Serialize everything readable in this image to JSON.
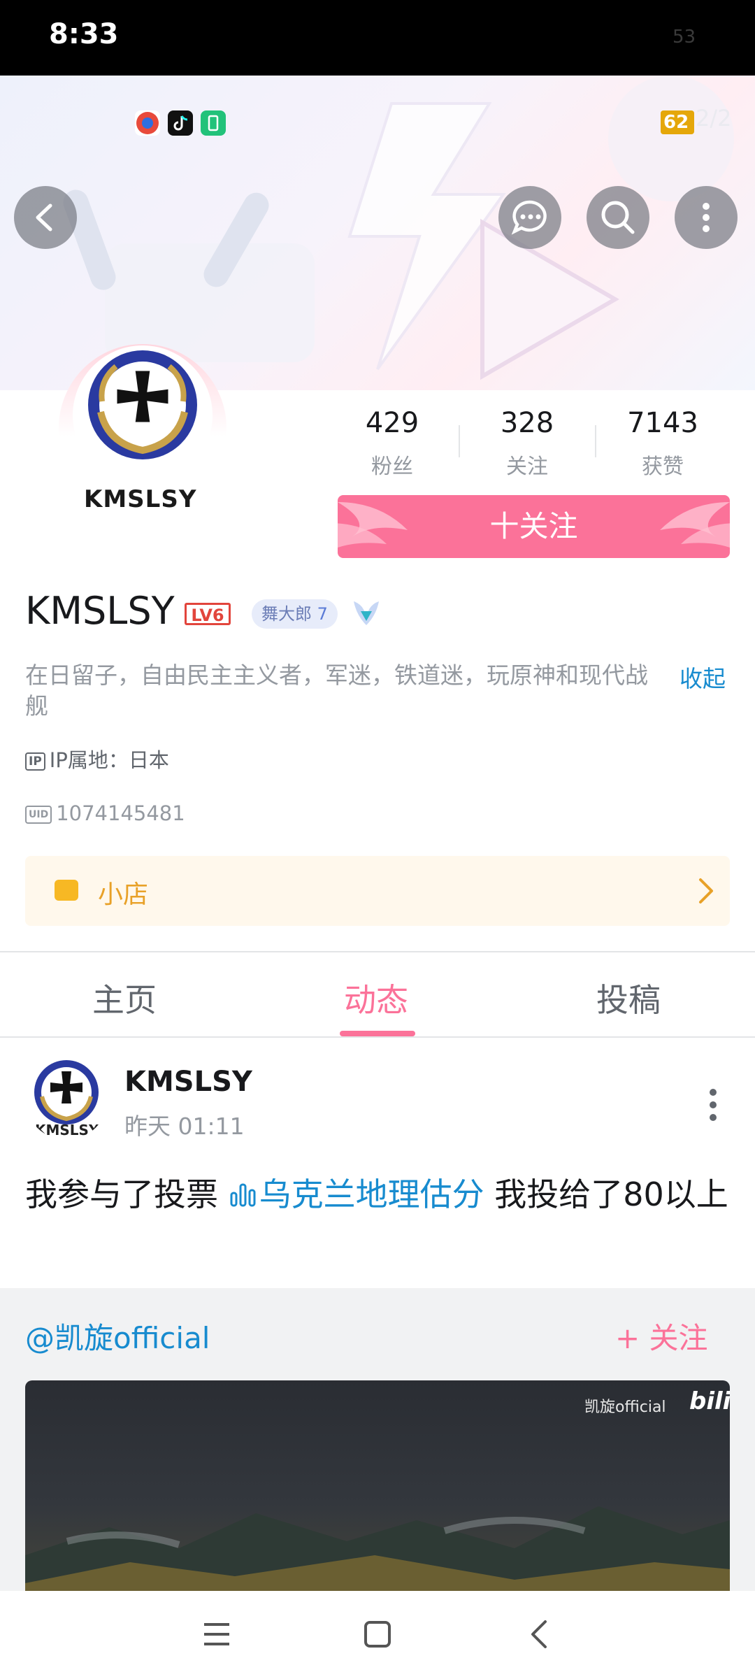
{
  "status": {
    "time": "8:33",
    "right_text": "53",
    "battery": "62",
    "counter": "2/2"
  },
  "colors": {
    "accent": "#fb7299",
    "link": "#178bcf",
    "level": "#e2453c",
    "shop": "#e8a128"
  },
  "header_buttons": [
    "back-icon",
    "message-icon",
    "search-icon",
    "more-icon"
  ],
  "profile": {
    "avatar_caption": "KMSLSY",
    "stats": [
      {
        "value": "429",
        "label": "粉丝"
      },
      {
        "value": "328",
        "label": "关注"
      },
      {
        "value": "7143",
        "label": "获赞"
      }
    ],
    "follow_label": "十关注",
    "name": "KMSLSY",
    "level": "LV6",
    "medal_name": "舞大郎",
    "medal_level": "7",
    "bio": "在日留子，自由民主主义者，军迷，铁道迷，玩原神和现代战舰",
    "collapse_label": "收起",
    "ip_icon": "IP",
    "ip_text": "IP属地：日本",
    "uid_icon": "UID",
    "uid": "1074145481",
    "shop_label": "小店"
  },
  "tabs": [
    {
      "label": "主页"
    },
    {
      "label": "动态"
    },
    {
      "label": "投稿"
    }
  ],
  "post": {
    "author": "KMSLSY",
    "avatar_caption": "KMSLSY",
    "time": "昨天 01:11",
    "text_before": "我参与了投票 ",
    "vote_link": "乌克兰地理估分",
    "text_after": " 我投给了80以上",
    "quoted_user": "@凯旋official",
    "quoted_follow": "+ 关注",
    "watermark": "凯旋official",
    "watermark_brand": "bilibili"
  }
}
